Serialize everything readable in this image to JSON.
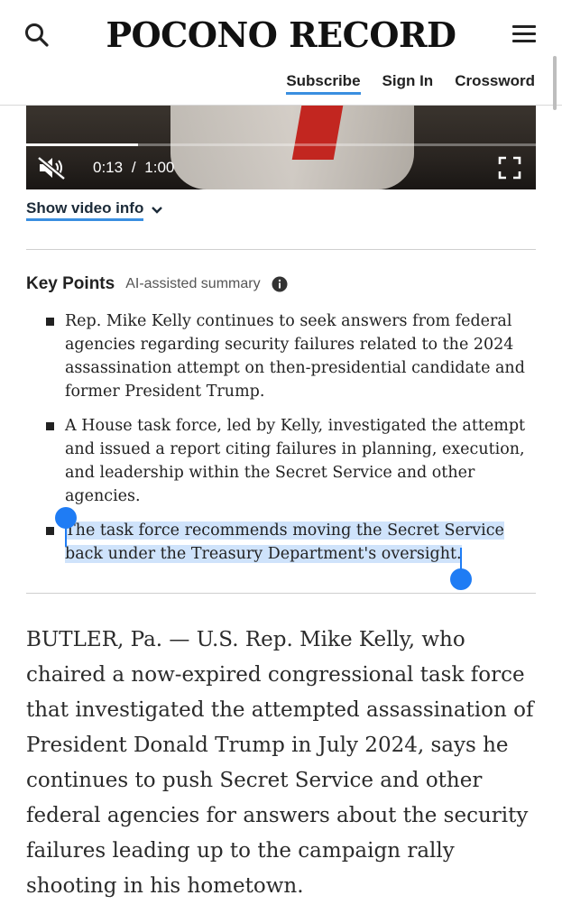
{
  "header": {
    "brand": "POCONO RECORD",
    "nav": {
      "subscribe": "Subscribe",
      "sign_in": "Sign In",
      "crossword": "Crossword"
    }
  },
  "video": {
    "progress_fraction": 0.22,
    "current_time": "0:13",
    "separator": "/",
    "duration": "1:00",
    "show_info_label": "Show video info"
  },
  "key_points": {
    "title": "Key Points",
    "subtitle": "AI-assisted summary",
    "items": [
      "Rep. Mike Kelly continues to seek answers from federal agencies regarding security failures related to the 2024 assassination attempt on then-presidential candidate and former President Trump.",
      "A House task force, led by Kelly, investigated the attempt and issued a report citing failures in planning, execution, and leadership within the Secret Service and other agencies.",
      "The task force recommends moving the Secret Service back under the Treasury Department's oversight."
    ]
  },
  "article": {
    "paragraph": "BUTLER, Pa. — U.S. Rep. Mike Kelly, who chaired a now-expired congressional task force that investigated the attempted assassination of President Donald Trump in July 2024, says he continues to push Secret Service and other federal agencies for answers about the security failures leading up to the campaign rally shooting in his hometown."
  },
  "colors": {
    "accent": "#3a8fe0",
    "selection": "#cfe3fb",
    "selection_handle": "#1f7cf4"
  }
}
